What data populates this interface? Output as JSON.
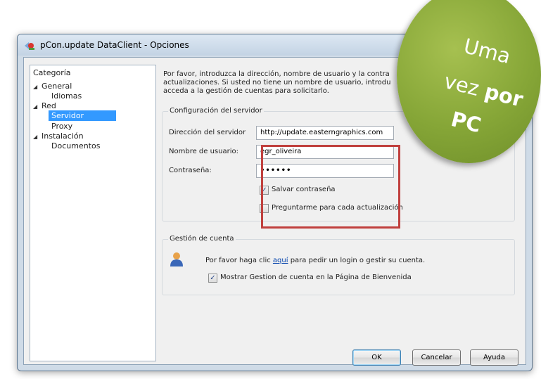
{
  "window": {
    "title": "pCon.update DataClient - Opciones"
  },
  "tree": {
    "header": "Categoría",
    "items": [
      {
        "label": "General"
      },
      {
        "label": "Idiomas"
      },
      {
        "label": "Red"
      },
      {
        "label": "Servidor"
      },
      {
        "label": "Proxy"
      },
      {
        "label": "Instalación"
      },
      {
        "label": "Documentos"
      }
    ]
  },
  "description": "Por favor, introduzca la dirección, nombre de usuario y la contra actualizaciones. Si usted no tiene un nombre de usuario, introdu acceda a la gestión de cuentas para solicitarlo.",
  "server": {
    "group_title": "Configuración del servidor",
    "address_label": "Dirección del servidor",
    "address_value": "http://update.easterngraphics.com",
    "user_label": "Nombre de usuario:",
    "user_value": "egr_oliveira",
    "password_label": "Contraseña:",
    "password_value": "••••••",
    "save_password_label": "Salvar contraseña",
    "ask_each_update_label": "Preguntarme para cada actualización"
  },
  "account": {
    "group_title": "Gestión de cuenta",
    "text_before": "Por favor haga clic ",
    "link": "aquí",
    "text_after": " para pedir un login o gestir su cuenta.",
    "show_label": "Mostrar Gestion de cuenta en la Página de Bienvenida"
  },
  "buttons": {
    "ok": "OK",
    "cancel": "Cancelar",
    "help": "Ayuda"
  },
  "badge": {
    "line1": "Uma",
    "line2_pre": "vez ",
    "line2_bold": "por",
    "line3": "PC"
  },
  "checks": {
    "save_password": "✓",
    "ask_each_update": "",
    "show_account": "✓"
  }
}
